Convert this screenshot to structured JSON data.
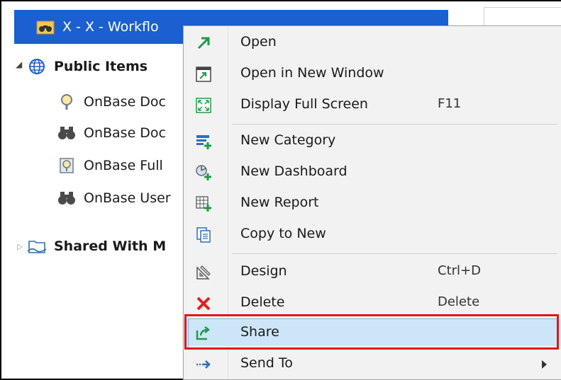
{
  "tree": {
    "selected_item": "X - X - Workflo",
    "public_items": "Public Items",
    "children": [
      "OnBase Doc",
      "OnBase Doc",
      "OnBase Full",
      "OnBase User"
    ],
    "shared": "Shared With M"
  },
  "menu": {
    "items": [
      {
        "label": "Open",
        "icon": "open-arrow-icon"
      },
      {
        "label": "Open in New Window",
        "icon": "new-window-icon"
      },
      {
        "label": "Display Full Screen",
        "shortcut": "F11",
        "icon": "full-screen-icon"
      },
      {
        "label": "New Category",
        "icon": "new-category-icon"
      },
      {
        "label": "New Dashboard",
        "icon": "new-dashboard-icon"
      },
      {
        "label": "New Report",
        "icon": "new-report-icon"
      },
      {
        "label": "Copy to New",
        "icon": "copy-icon"
      },
      {
        "label": "Design",
        "shortcut": "Ctrl+D",
        "icon": "design-icon"
      },
      {
        "label": "Delete",
        "shortcut": "Delete",
        "icon": "delete-icon"
      },
      {
        "label": "Share",
        "icon": "share-icon"
      },
      {
        "label": "Send To",
        "icon": "send-to-icon"
      }
    ]
  },
  "colors": {
    "selection": "#1b5fd0",
    "highlight": "#e01616",
    "hover": "#cde6f7"
  }
}
